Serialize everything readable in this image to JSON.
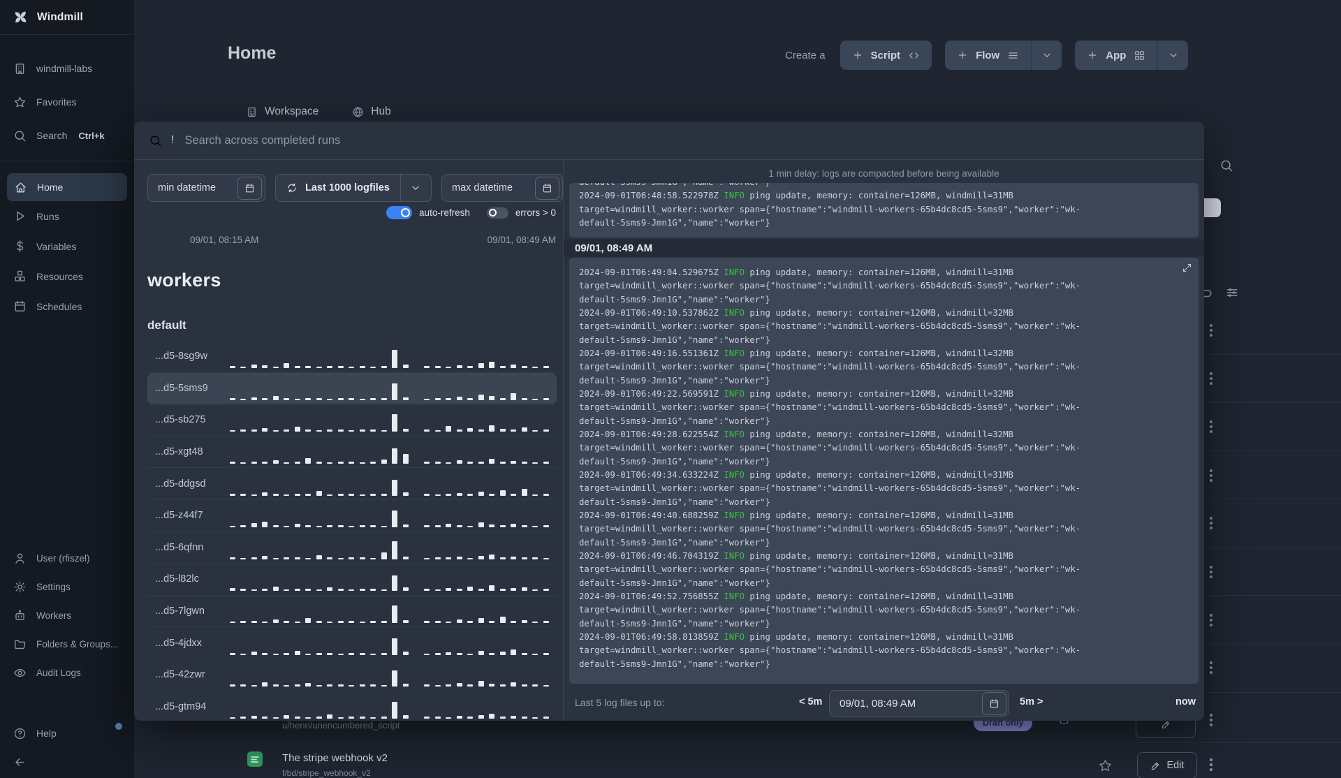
{
  "colors": {
    "accent_blue": "#3b82f6",
    "info_green": "#38c13e",
    "modal_bg": "#2a323f",
    "log_block_bg": "#3d4656",
    "sidebar_bg": "#141922",
    "badge_indigo": "#868dd8",
    "script_green": "#2d9c5f"
  },
  "sidebar": {
    "app_name": "Windmill",
    "workspace": {
      "label": "windmill-labs"
    },
    "favorites": {
      "label": "Favorites"
    },
    "search": {
      "label": "Search",
      "kbd": "Ctrl+k"
    },
    "nav": {
      "home": "Home",
      "runs": "Runs",
      "variables": "Variables",
      "resources": "Resources",
      "schedules": "Schedules"
    },
    "bottom": {
      "user": "User (rfiszel)",
      "settings": "Settings",
      "workers": "Workers",
      "folders": "Folders & Groups...",
      "audit": "Audit Logs",
      "help": "Help"
    }
  },
  "header": {
    "title": "Home",
    "create_label": "Create a",
    "script_button": "Script",
    "flow_button": "Flow",
    "app_button": "App"
  },
  "tabs": {
    "workspace": "Workspace",
    "hub": "Hub"
  },
  "modal": {
    "search_prefix": "!",
    "search_placeholder": "Search across completed runs",
    "filters": {
      "min_datetime": "min datetime",
      "logfiles": "Last 1000 logfiles",
      "max_datetime": "max datetime",
      "auto_refresh": "auto-refresh",
      "errors": "errors > 0"
    },
    "range": {
      "start": "09/01, 08:15 AM",
      "end": "09/01, 08:49 AM"
    },
    "workers_title": "workers",
    "group_title": "default",
    "workers": [
      {
        "name": "...d5-8sg9w",
        "selected": false,
        "bars": [
          3,
          2,
          5,
          4,
          2,
          7,
          3,
          3,
          2,
          3,
          3,
          2,
          3,
          2,
          3,
          26,
          5,
          0,
          3,
          3,
          2,
          4,
          3,
          7,
          9,
          3,
          5,
          3,
          2,
          3
        ]
      },
      {
        "name": "...d5-5sms9",
        "selected": true,
        "bars": [
          3,
          2,
          4,
          3,
          6,
          3,
          2,
          3,
          3,
          2,
          3,
          3,
          2,
          3,
          3,
          24,
          4,
          0,
          2,
          3,
          3,
          5,
          3,
          8,
          6,
          3,
          10,
          3,
          2,
          3
        ]
      },
      {
        "name": "...d5-sb275",
        "selected": false,
        "bars": [
          2,
          3,
          3,
          5,
          2,
          3,
          7,
          3,
          2,
          3,
          3,
          2,
          3,
          3,
          2,
          25,
          4,
          0,
          3,
          2,
          8,
          3,
          5,
          3,
          9,
          4,
          3,
          6,
          2,
          3
        ]
      },
      {
        "name": "...d5-xgt48",
        "selected": false,
        "bars": [
          3,
          2,
          3,
          3,
          5,
          2,
          3,
          8,
          3,
          2,
          3,
          3,
          2,
          3,
          6,
          22,
          14,
          0,
          3,
          3,
          2,
          5,
          3,
          3,
          7,
          3,
          4,
          3,
          2,
          3
        ]
      },
      {
        "name": "...d5-ddgsd",
        "selected": false,
        "bars": [
          3,
          3,
          2,
          5,
          3,
          2,
          3,
          3,
          7,
          2,
          3,
          3,
          2,
          3,
          3,
          23,
          5,
          0,
          3,
          2,
          3,
          4,
          3,
          6,
          3,
          8,
          3,
          10,
          2,
          3
        ]
      },
      {
        "name": "...d5-z44f7",
        "selected": false,
        "bars": [
          2,
          3,
          6,
          8,
          3,
          2,
          5,
          3,
          2,
          3,
          3,
          2,
          3,
          3,
          2,
          24,
          4,
          0,
          3,
          3,
          5,
          3,
          2,
          7,
          4,
          3,
          5,
          3,
          2,
          3
        ]
      },
      {
        "name": "...d5-6qfnn",
        "selected": false,
        "bars": [
          3,
          2,
          3,
          5,
          2,
          3,
          3,
          2,
          6,
          3,
          2,
          3,
          3,
          2,
          10,
          26,
          4,
          0,
          2,
          3,
          3,
          4,
          2,
          5,
          7,
          3,
          4,
          3,
          3,
          2
        ]
      },
      {
        "name": "...d5-l82lc",
        "selected": false,
        "bars": [
          4,
          3,
          2,
          3,
          6,
          2,
          3,
          3,
          2,
          5,
          3,
          2,
          3,
          3,
          2,
          22,
          5,
          0,
          3,
          2,
          4,
          3,
          6,
          3,
          8,
          3,
          4,
          5,
          2,
          3
        ]
      },
      {
        "name": "...d5-7lgwn",
        "selected": false,
        "bars": [
          2,
          3,
          3,
          2,
          5,
          3,
          2,
          7,
          3,
          2,
          3,
          3,
          2,
          3,
          3,
          25,
          4,
          0,
          3,
          3,
          2,
          5,
          3,
          7,
          3,
          9,
          3,
          4,
          2,
          3
        ]
      },
      {
        "name": "...d5-4jdxx",
        "selected": false,
        "bars": [
          3,
          2,
          5,
          3,
          2,
          3,
          6,
          2,
          3,
          3,
          2,
          3,
          3,
          2,
          3,
          24,
          5,
          0,
          2,
          3,
          4,
          3,
          2,
          6,
          3,
          5,
          8,
          3,
          2,
          3
        ]
      },
      {
        "name": "...d5-42zwr",
        "selected": false,
        "bars": [
          3,
          3,
          2,
          6,
          3,
          2,
          3,
          5,
          2,
          3,
          3,
          2,
          3,
          3,
          2,
          23,
          4,
          0,
          3,
          2,
          3,
          5,
          3,
          8,
          4,
          3,
          6,
          3,
          3,
          2
        ]
      },
      {
        "name": "...d5-gtm94",
        "selected": false,
        "bars": [
          2,
          3,
          4,
          3,
          2,
          5,
          3,
          2,
          3,
          6,
          2,
          3,
          3,
          2,
          3,
          24,
          5,
          0,
          3,
          3,
          2,
          4,
          3,
          5,
          7,
          3,
          4,
          3,
          2,
          3
        ]
      }
    ],
    "log": {
      "delay_note": "1 min delay: logs are compacted before being available",
      "section_header": "09/01, 08:49 AM",
      "level": "INFO",
      "target_line": "target=windmill_worker::worker span={\"hostname\":\"windmill-workers-65b4dc8cd5-5sms9\",\"worker\":\"wk-",
      "cont_line": "default-5sms9-Jmn1G\",\"name\":\"worker\"}",
      "top_entries": [
        {
          "ts": "2024-09-01T06:48:58.522978Z",
          "msg": "ping update, memory: container=126MB, windmill=31MB"
        }
      ],
      "entries": [
        {
          "ts": "2024-09-01T06:49:04.529675Z",
          "msg": "ping update, memory: container=126MB, windmill=31MB"
        },
        {
          "ts": "2024-09-01T06:49:10.537862Z",
          "msg": "ping update, memory: container=126MB, windmill=32MB"
        },
        {
          "ts": "2024-09-01T06:49:16.551361Z",
          "msg": "ping update, memory: container=126MB, windmill=32MB"
        },
        {
          "ts": "2024-09-01T06:49:22.569591Z",
          "msg": "ping update, memory: container=126MB, windmill=32MB"
        },
        {
          "ts": "2024-09-01T06:49:28.622554Z",
          "msg": "ping update, memory: container=126MB, windmill=32MB"
        },
        {
          "ts": "2024-09-01T06:49:34.633224Z",
          "msg": "ping update, memory: container=126MB, windmill=31MB"
        },
        {
          "ts": "2024-09-01T06:49:40.688259Z",
          "msg": "ping update, memory: container=126MB, windmill=31MB"
        },
        {
          "ts": "2024-09-01T06:49:46.704319Z",
          "msg": "ping update, memory: container=126MB, windmill=31MB"
        },
        {
          "ts": "2024-09-01T06:49:52.756855Z",
          "msg": "ping update, memory: container=126MB, windmill=31MB"
        },
        {
          "ts": "2024-09-01T06:49:58.813859Z",
          "msg": "ping update, memory: container=126MB, windmill=31MB"
        }
      ],
      "footer": {
        "label": "Last 5 log files up to:",
        "back": "< 5m",
        "datetime": "09/01, 08:49 AM",
        "forward": "5m >",
        "now": "now"
      }
    }
  },
  "background_rows": {
    "row_a": {
      "path": "u/henri/unencumbered_script",
      "badge": "Draft only"
    },
    "row_b": {
      "title": "The stripe webhook v2",
      "path": "f/bd/stripe_webhook_v2",
      "edit_label": "Edit"
    }
  }
}
